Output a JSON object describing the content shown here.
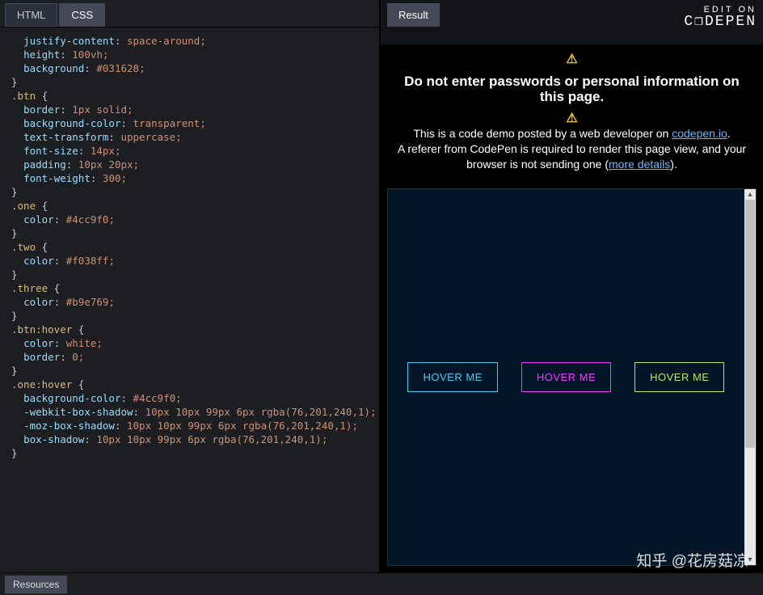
{
  "tabs": {
    "html": "HTML",
    "css": "CSS"
  },
  "result_button": "Result",
  "edit_on": {
    "label": "EDIT ON",
    "logo": "C❐DEPEN"
  },
  "warning": {
    "icon": "⚠",
    "headline": "Do not enter passwords or personal information on this page.",
    "line1a": "This is a code demo posted by a web developer on ",
    "link1": "codepen.io",
    "line1b": ".",
    "line2a": "A referer from CodePen is required to render this page view, and your browser is not sending one (",
    "link2": "more details",
    "line2b": ")."
  },
  "preview": {
    "buttons": [
      {
        "label": "HOVER ME",
        "cls": "one"
      },
      {
        "label": "HOVER ME",
        "cls": "two"
      },
      {
        "label": "HOVER ME",
        "cls": "three"
      }
    ]
  },
  "footer": {
    "resources": "Resources"
  },
  "watermark": "知乎 @花房菇凉",
  "code_lines": [
    "  justify-content: space-around;",
    "  height: 100vh;",
    "  background: #031628;",
    "}",
    "",
    ".btn {",
    "  border: 1px solid;",
    "  background-color: transparent;",
    "  text-transform: uppercase;",
    "  font-size: 14px;",
    "  padding: 10px 20px;",
    "  font-weight: 300;",
    "}",
    "",
    ".one {",
    "  color: #4cc9f0;",
    "}",
    "",
    ".two {",
    "  color: #f038ff;",
    "}",
    "",
    ".three {",
    "  color: #b9e769;",
    "}",
    "",
    ".btn:hover {",
    "  color: white;",
    "  border: 0;",
    "}",
    "",
    ".one:hover {",
    "  background-color: #4cc9f0;",
    "  -webkit-box-shadow: 10px 10px 99px 6px rgba(76,201,240,1);",
    "  -moz-box-shadow: 10px 10px 99px 6px rgba(76,201,240,1);",
    "  box-shadow: 10px 10px 99px 6px rgba(76,201,240,1);",
    "}"
  ]
}
